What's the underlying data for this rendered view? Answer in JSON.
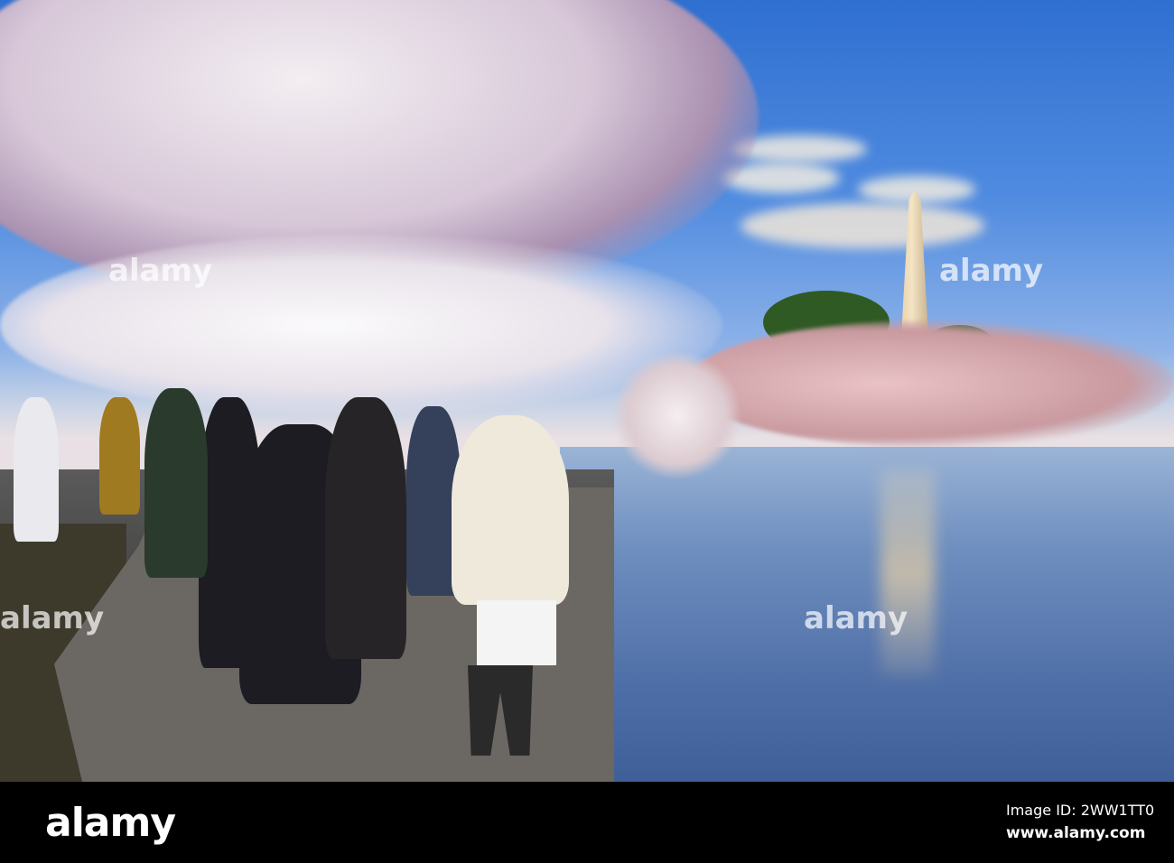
{
  "footer": {
    "logo": "alamy",
    "image_id": "Image ID: 2WW1TT0",
    "url": "www.alamy.com"
  },
  "watermark": "alamy"
}
